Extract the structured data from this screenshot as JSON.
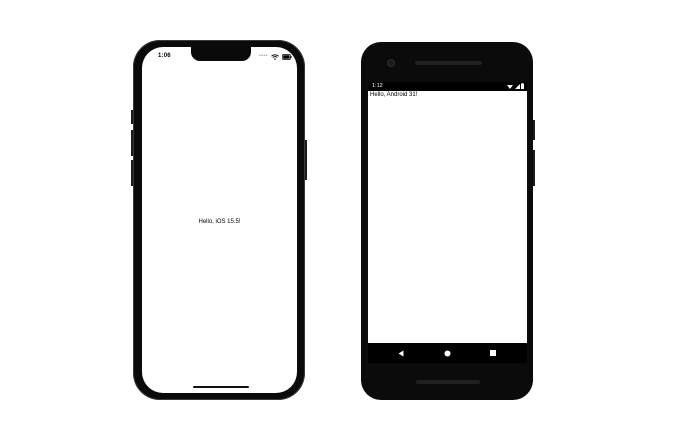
{
  "ios_device": {
    "status_time": "1:06",
    "greeting": "Hello, iOS 15.5!"
  },
  "android_device": {
    "status_time": "1:12",
    "greeting": "Hello, Android 31!"
  },
  "icons": {
    "ios": [
      "signal-dots-icon",
      "wifi-icon",
      "battery-icon"
    ],
    "android": [
      "wifi-icon",
      "cellular-icon",
      "battery-icon",
      "back-icon",
      "home-icon",
      "recents-icon"
    ]
  },
  "colors": {
    "device_body": "#0a0a0a",
    "screen_bg": "#ffffff",
    "text": "#000000"
  }
}
